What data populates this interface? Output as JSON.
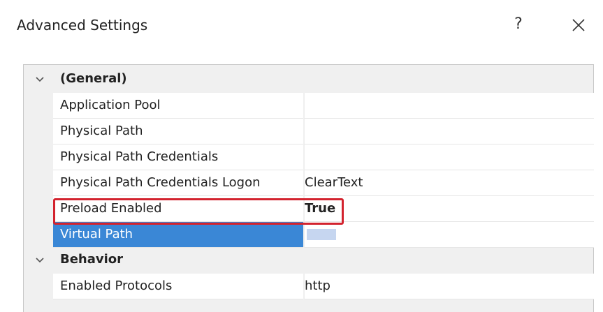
{
  "window": {
    "title": "Advanced Settings",
    "help_label": "?",
    "close_icon": "close-icon"
  },
  "grid": {
    "categories": [
      {
        "label": "(General)",
        "expanded": true,
        "properties": [
          {
            "name": "Application Pool",
            "value": ""
          },
          {
            "name": "Physical Path",
            "value": ""
          },
          {
            "name": "Physical Path Credentials",
            "value": ""
          },
          {
            "name": "Physical Path Credentials Logon",
            "value": "ClearText"
          },
          {
            "name": "Preload Enabled",
            "value": "True",
            "bold": true,
            "highlighted": true
          },
          {
            "name": "Virtual Path",
            "value": "",
            "selected": true
          }
        ]
      },
      {
        "label": "Behavior",
        "expanded": true,
        "properties": [
          {
            "name": "Enabled Protocols",
            "value": "http"
          }
        ]
      }
    ]
  },
  "colors": {
    "selection": "#3a87d6",
    "highlight_border": "#d3232e",
    "grid_margin": "#f0f0f0"
  }
}
